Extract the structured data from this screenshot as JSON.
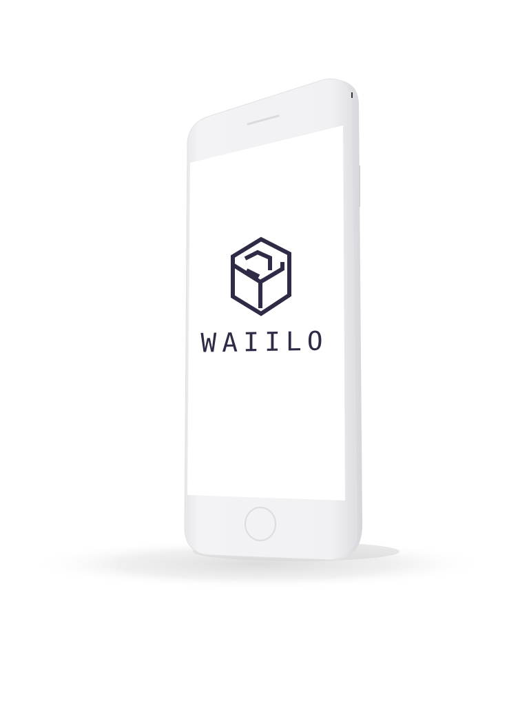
{
  "brand": {
    "name": "WAIILO",
    "logo_icon": "hexagon-cube-logo"
  },
  "colors": {
    "logo": "#2f2a45",
    "phone_body": "#efeff1",
    "screen": "#ffffff"
  }
}
